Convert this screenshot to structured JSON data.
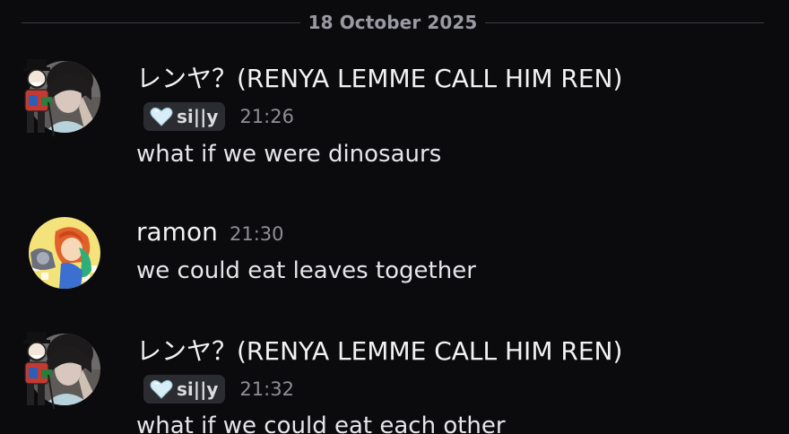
{
  "date_divider": "18 October 2025",
  "messages": [
    {
      "username": "レンヤ？(RENYA LEMME CALL HIM REN)",
      "tag": "si||y",
      "timestamp": "21:26",
      "content": "what if we were dinosaurs",
      "avatar_icon": "user-avatar-renya-icon",
      "decoration_icon": "avatar-decoration-icon"
    },
    {
      "username": "ramon",
      "timestamp": "21:30",
      "content": "we could eat leaves together",
      "avatar_icon": "user-avatar-ramon-icon"
    },
    {
      "username": "レンヤ？(RENYA LEMME CALL HIM REN)",
      "tag": "si||y",
      "timestamp": "21:32",
      "content": "what if we could eat each other",
      "avatar_icon": "user-avatar-renya-icon",
      "decoration_icon": "avatar-decoration-icon"
    }
  ],
  "colors": {
    "background": "#0b0b0e",
    "text": "#e6e6ea",
    "muted": "#8e8f96",
    "tag_bg": "#2b2c31",
    "heart": "#d8eef7"
  }
}
